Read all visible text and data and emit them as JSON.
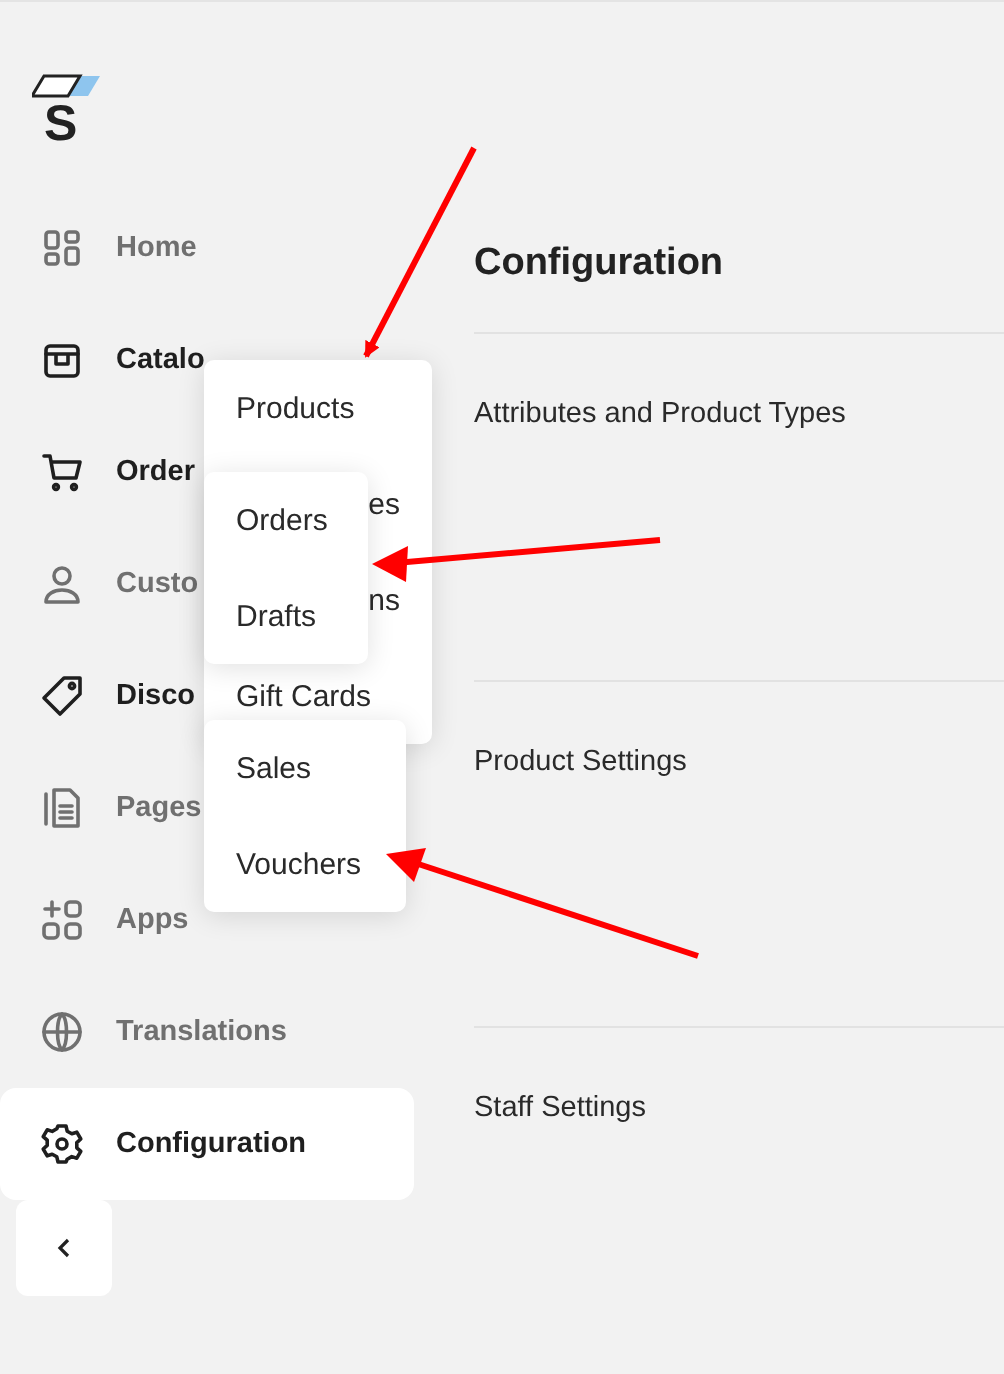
{
  "logo": {
    "letter": "S"
  },
  "sidebar": {
    "items": [
      {
        "label": "Home",
        "expanded": false,
        "selected": false
      },
      {
        "label": "Catalo",
        "expanded": true,
        "selected": false
      },
      {
        "label": "Order",
        "expanded": true,
        "selected": false
      },
      {
        "label": "Custo",
        "expanded": false,
        "selected": false
      },
      {
        "label": "Disco",
        "expanded": true,
        "selected": false
      },
      {
        "label": "Pages",
        "expanded": false,
        "selected": false
      },
      {
        "label": "Apps",
        "expanded": false,
        "selected": false
      },
      {
        "label": "Translations",
        "expanded": false,
        "selected": false
      },
      {
        "label": "Configuration",
        "expanded": false,
        "selected": true
      }
    ]
  },
  "main": {
    "title": "Configuration",
    "sections": [
      {
        "label": "Attributes and Product Types"
      },
      {
        "label": "Product Settings"
      },
      {
        "label": "Staff Settings"
      }
    ]
  },
  "menus": [
    {
      "items": [
        {
          "label": "Products",
          "kind": "full"
        },
        {
          "label": "es",
          "kind": "tail"
        },
        {
          "label": "ns",
          "kind": "tail"
        },
        {
          "label": "Gift Cards",
          "kind": "full"
        }
      ]
    },
    {
      "items": [
        {
          "label": "Orders",
          "kind": "full"
        },
        {
          "label": "Drafts",
          "kind": "full"
        }
      ]
    },
    {
      "items": [
        {
          "label": "Sales",
          "kind": "full"
        },
        {
          "label": "Vouchers",
          "kind": "full"
        }
      ]
    }
  ]
}
